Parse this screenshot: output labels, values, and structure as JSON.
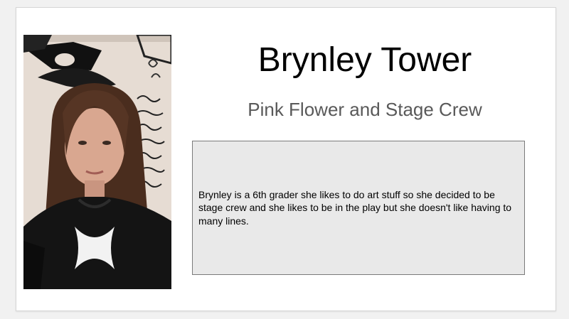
{
  "slide": {
    "title": "Brynley Tower",
    "subtitle": "Pink Flower and Stage Crew",
    "bio": "Brynley is a 6th grader she likes to do art stuff so she decided to be stage crew and she likes to be in the play but she doesn't like having to many lines."
  },
  "colors": {
    "background": "#f1f1f1",
    "slide": "#ffffff",
    "subtitle": "#595959",
    "bio_box": "#e9e9e9",
    "bio_border": "#7a7a7a"
  }
}
